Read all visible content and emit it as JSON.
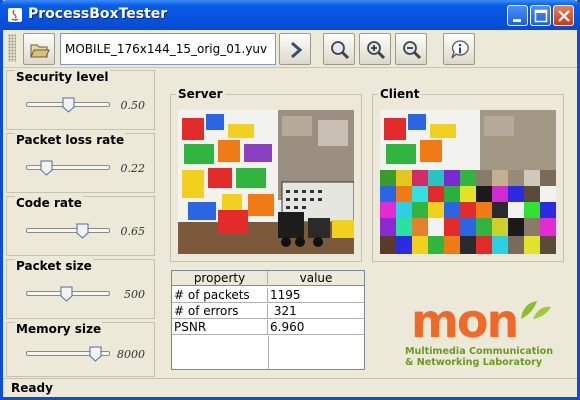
{
  "window": {
    "title": "ProcessBoxTester"
  },
  "toolbar": {
    "file_name": "MOBILE_176x144_15_orig_01.yuv",
    "icons": [
      "folder-open-icon",
      "arrow-right-icon",
      "zoom-icon",
      "zoom-in-icon",
      "zoom-out-icon",
      "info-icon"
    ]
  },
  "controls": [
    {
      "label": "Security level",
      "value": "0.50",
      "position": 0.5
    },
    {
      "label": "Packet loss rate",
      "value": "0.22",
      "position": 0.22
    },
    {
      "label": "Code rate",
      "value": "0.65",
      "position": 0.65
    },
    {
      "label": "Packet size",
      "value": "500",
      "position": 0.45
    },
    {
      "label": "Memory size",
      "value": "8000",
      "position": 0.8
    }
  ],
  "server": {
    "title": "Server"
  },
  "client": {
    "title": "Client"
  },
  "table": {
    "headers": [
      "property",
      "value"
    ],
    "rows": [
      [
        "# of packets",
        "1195"
      ],
      [
        "# of errors",
        " 321"
      ],
      [
        "PSNR",
        "6.960"
      ]
    ]
  },
  "logo": {
    "mark": "mon",
    "line1": "Multimedia Communication",
    "line2": "& Networking Laboratory",
    "colors": {
      "mark": "#ef6a2a",
      "leaf": "#8cbf2a",
      "text": "#6a9a20"
    }
  },
  "status": {
    "text": "Ready"
  },
  "colors": {
    "title_bar": "#0553e0",
    "window_bg": "#ece9d8"
  }
}
